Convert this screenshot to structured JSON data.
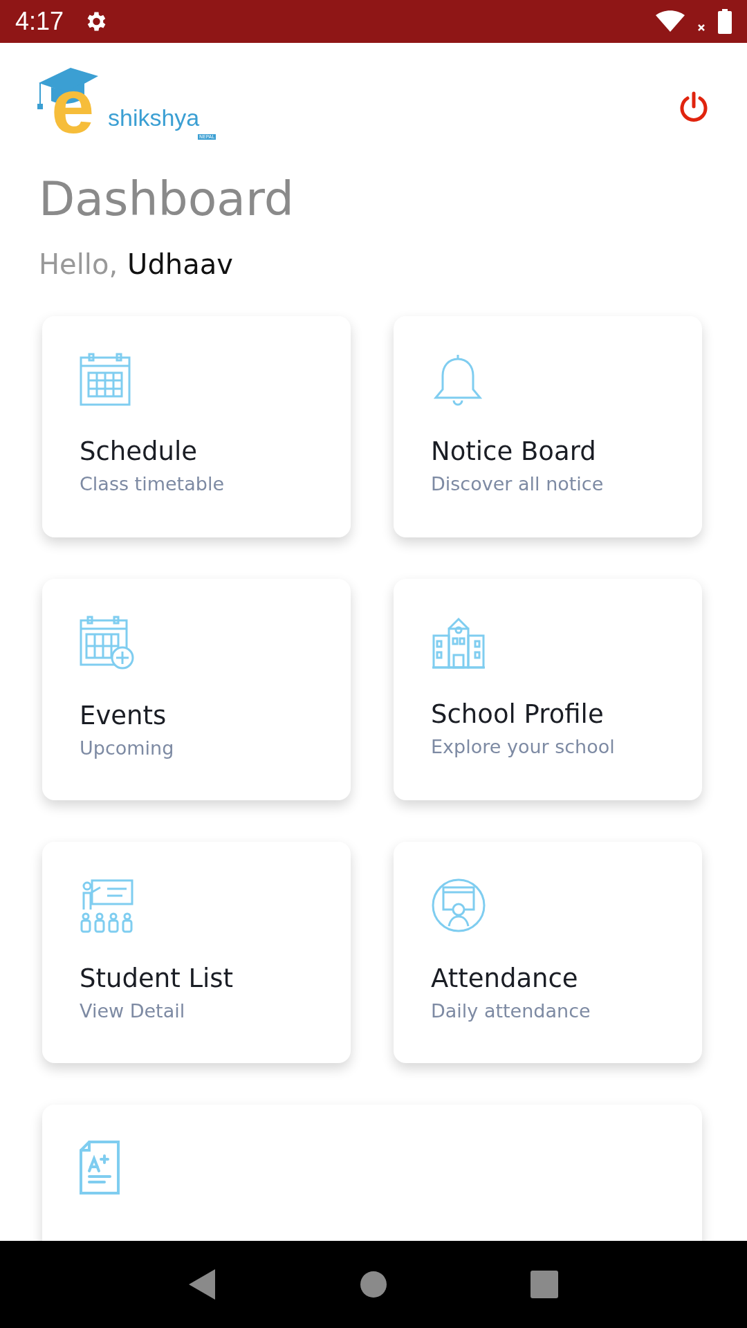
{
  "status_bar": {
    "time": "4:17"
  },
  "logo": {
    "letter": "e",
    "name": "shikshya",
    "tag": "NEPAL"
  },
  "title": "Dashboard",
  "greeting": {
    "prefix": "Hello,",
    "name": "Udhaav"
  },
  "cards": [
    {
      "kind": "calendar",
      "title": "Schedule",
      "subtitle": "Class timetable"
    },
    {
      "kind": "bell",
      "title": "Notice Board",
      "subtitle": "Discover all notice"
    },
    {
      "kind": "calendar-plus",
      "title": "Events",
      "subtitle": "Upcoming"
    },
    {
      "kind": "building",
      "title": "School Profile",
      "subtitle": "Explore your school"
    },
    {
      "kind": "classroom",
      "title": "Student List",
      "subtitle": "View Detail"
    },
    {
      "kind": "monitor",
      "title": "Attendance",
      "subtitle": "Daily attendance"
    },
    {
      "kind": "grade",
      "wide": true
    }
  ]
}
